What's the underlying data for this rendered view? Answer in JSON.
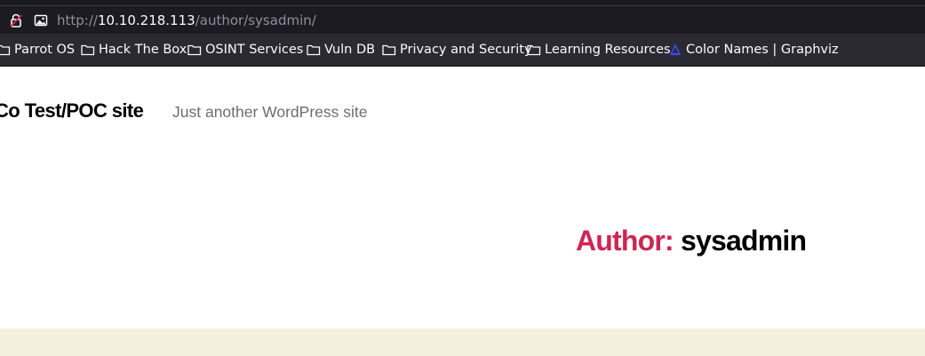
{
  "browser": {
    "url": {
      "protocol": "http://",
      "host": "10.10.218.113",
      "path": "/author/sysadmin/"
    },
    "icons": {
      "lock": "insecure-lock-icon",
      "permissions": "image-permission-icon"
    },
    "bookmarks": [
      {
        "label": "Parrot OS",
        "icon": "folder-icon"
      },
      {
        "label": "Hack The Box",
        "icon": "folder-icon"
      },
      {
        "label": "OSINT Services",
        "icon": "folder-icon"
      },
      {
        "label": "Vuln DB",
        "icon": "folder-icon"
      },
      {
        "label": "Privacy and Security",
        "icon": "folder-icon"
      },
      {
        "label": "Learning Resources",
        "icon": "folder-icon"
      },
      {
        "label": "Color Names | Graphviz",
        "icon": "graphviz-favicon-icon"
      }
    ]
  },
  "site": {
    "title": "Co Test/POC site",
    "description": "Just another WordPress site"
  },
  "archive": {
    "prefix": "Author:",
    "name": "sysadmin"
  },
  "colors": {
    "accent": "#cd2653",
    "footer_band": "#f5efe0",
    "toolbar": "#1c1b22",
    "bookmarks_bar": "#2b2a33"
  }
}
